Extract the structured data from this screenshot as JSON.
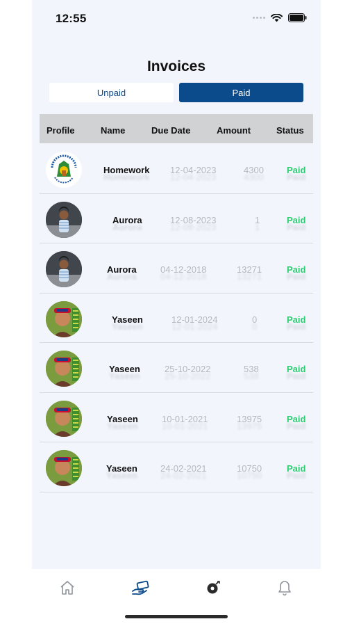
{
  "status_bar": {
    "time": "12:55"
  },
  "header": {
    "title": "Invoices"
  },
  "tabs": {
    "unpaid": "Unpaid",
    "paid": "Paid",
    "selected": "Paid"
  },
  "table": {
    "columns": [
      "Profile",
      "Name",
      "Due Date",
      "Amount",
      "Status"
    ],
    "rows": [
      {
        "avatar": "school-logo",
        "name": "Homework",
        "due_date": "12-04-2023",
        "amount": "4300",
        "status": "Paid"
      },
      {
        "avatar": "girl-photo",
        "name": "Aurora",
        "due_date": "12-08-2023",
        "amount": "1",
        "status": "Paid"
      },
      {
        "avatar": "girl-photo",
        "name": "Aurora",
        "due_date": "04-12-2018",
        "amount": "13271",
        "status": "Paid"
      },
      {
        "avatar": "boy-photo",
        "name": "Yaseen",
        "due_date": "12-01-2024",
        "amount": "0",
        "status": "Paid"
      },
      {
        "avatar": "boy-photo",
        "name": "Yaseen",
        "due_date": "25-10-2022",
        "amount": "538",
        "status": "Paid"
      },
      {
        "avatar": "boy-photo",
        "name": "Yaseen",
        "due_date": "10-01-2021",
        "amount": "13975",
        "status": "Paid"
      },
      {
        "avatar": "boy-photo",
        "name": "Yaseen",
        "due_date": "24-02-2021",
        "amount": "10750",
        "status": "Paid"
      }
    ]
  },
  "tabbar": {
    "items": [
      {
        "icon": "home-icon",
        "active": false
      },
      {
        "icon": "payment-icon",
        "active": true
      },
      {
        "icon": "activity-icon",
        "active": false
      },
      {
        "icon": "bell-icon",
        "active": false
      }
    ]
  },
  "colors": {
    "primary": "#0b4a8b",
    "paid_status": "#2ecc71",
    "muted_text": "#b5b8bd",
    "header_bg": "#d1d2d4",
    "page_bg": "#f2f6fc"
  }
}
